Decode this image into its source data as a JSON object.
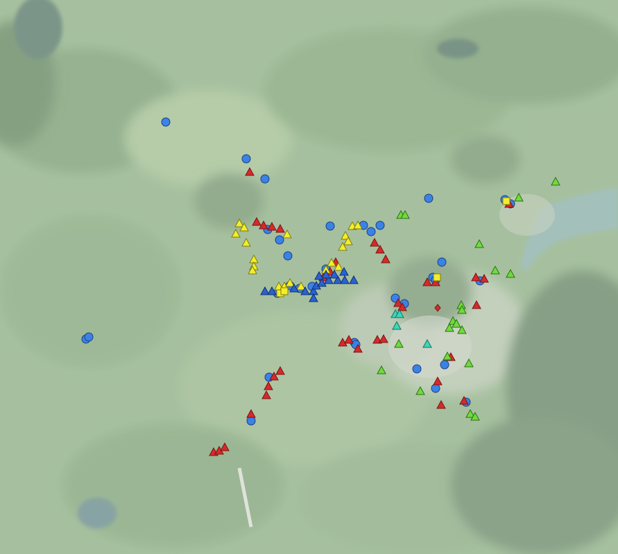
{
  "map": {
    "style": "satellite imagery, washed-out overlay",
    "marker_styles": {
      "blue-circle": {
        "shape": "circle",
        "fill": "#3a82e6",
        "stroke": "#1f3f7a"
      },
      "red-triangle": {
        "shape": "triangle",
        "fill": "#d62a2a",
        "stroke": "#7a1212"
      },
      "yellow-triangle": {
        "shape": "triangle",
        "fill": "#f3ee2a",
        "stroke": "#7d7a10"
      },
      "yellow-square": {
        "shape": "square",
        "fill": "#f3ee2a",
        "stroke": "#7d7a10"
      },
      "green-triangle": {
        "shape": "triangle",
        "fill": "#6fdb3c",
        "stroke": "#2c6e14"
      },
      "blue-triangle": {
        "shape": "triangle",
        "fill": "#2a62d2",
        "stroke": "#0f2f6e"
      },
      "teal-triangle": {
        "shape": "triangle",
        "fill": "#3ad8b8",
        "stroke": "#147060"
      },
      "red-diamond": {
        "shape": "diamond",
        "fill": "#d62a2a",
        "stroke": "#7a1212"
      }
    }
  }
}
